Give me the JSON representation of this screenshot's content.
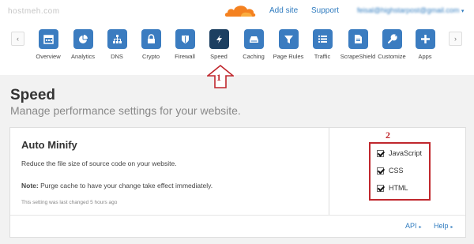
{
  "header": {
    "domain": "hostmeh.com",
    "add_site": "Add site",
    "support": "Support",
    "account": "feisal@highstarpost@gmail.com",
    "account_caret": "▾"
  },
  "nav": {
    "prev_arrow": "‹",
    "next_arrow": "›",
    "items": [
      {
        "label": "Overview",
        "icon": "overview-icon"
      },
      {
        "label": "Analytics",
        "icon": "analytics-icon"
      },
      {
        "label": "DNS",
        "icon": "dns-icon"
      },
      {
        "label": "Crypto",
        "icon": "lock-icon"
      },
      {
        "label": "Firewall",
        "icon": "shield-icon"
      },
      {
        "label": "Speed",
        "icon": "lightning-icon",
        "active": true
      },
      {
        "label": "Caching",
        "icon": "drive-icon"
      },
      {
        "label": "Page Rules",
        "icon": "filter-icon"
      },
      {
        "label": "Traffic",
        "icon": "list-icon"
      },
      {
        "label": "ScrapeShield",
        "icon": "document-icon"
      },
      {
        "label": "Customize",
        "icon": "wrench-icon"
      },
      {
        "label": "Apps",
        "icon": "plus-icon"
      }
    ],
    "active_color": "#1c3f61",
    "tile_color": "#3b7cc0"
  },
  "annotations": {
    "one": "1",
    "two": "2",
    "color": "#c0272d"
  },
  "page": {
    "title": "Speed",
    "subtitle": "Manage performance settings for your website."
  },
  "card": {
    "title": "Auto Minify",
    "description": "Reduce the file size of source code on your website.",
    "note_label": "Note:",
    "note_text": " Purge cache to have your change take effect immediately.",
    "last_changed": "This setting was last changed 5 hours ago",
    "options": [
      {
        "label": "JavaScript",
        "checked": true
      },
      {
        "label": "CSS",
        "checked": true
      },
      {
        "label": "HTML",
        "checked": true
      }
    ],
    "footer": {
      "api": "API",
      "help": "Help",
      "triangle": "▸"
    }
  }
}
